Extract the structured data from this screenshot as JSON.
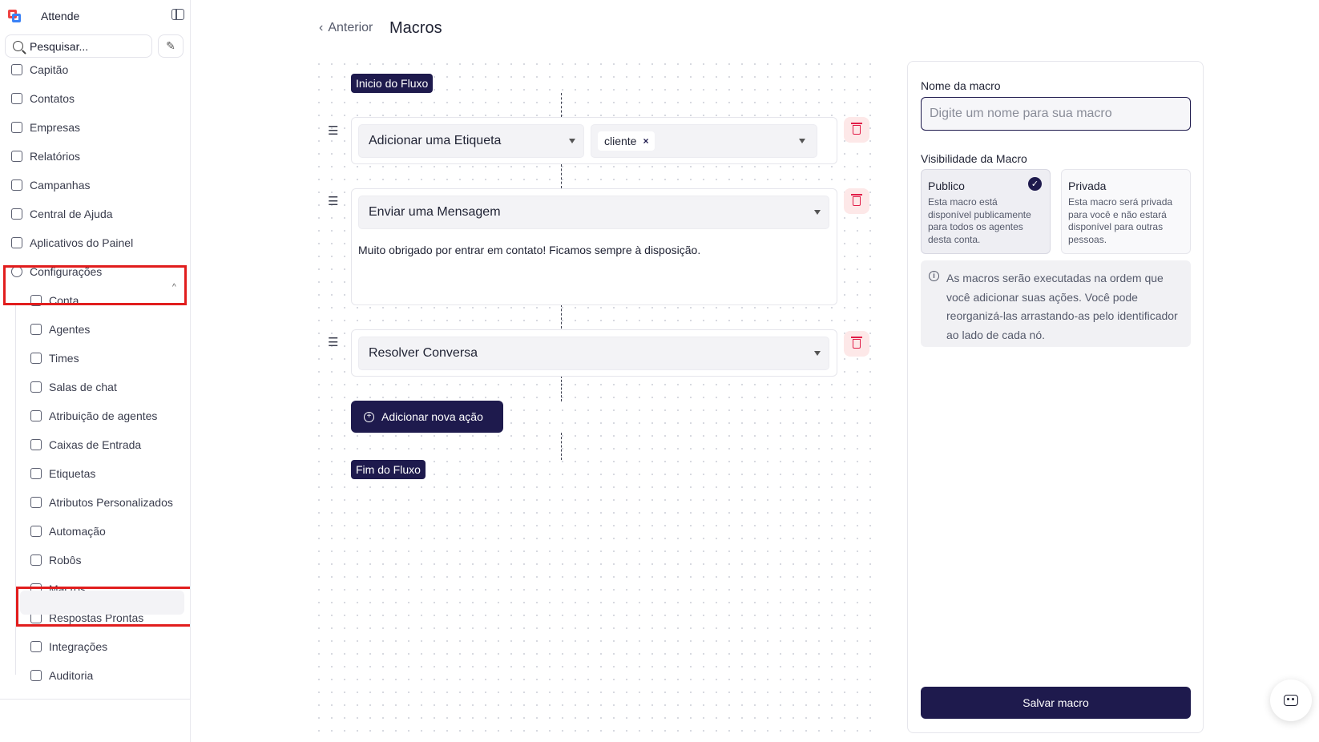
{
  "app": {
    "name": "Attende"
  },
  "search": {
    "placeholder": "Pesquisar..."
  },
  "sidebar": {
    "items": [
      {
        "label": "Capitão",
        "icon": "flag-icon"
      },
      {
        "label": "Contatos",
        "icon": "contact-icon"
      },
      {
        "label": "Empresas",
        "icon": "building-icon"
      },
      {
        "label": "Relatórios",
        "icon": "chart-icon"
      },
      {
        "label": "Campanhas",
        "icon": "megaphone-icon"
      },
      {
        "label": "Central de Ajuda",
        "icon": "library-icon"
      },
      {
        "label": "Aplicativos do Painel",
        "icon": "apps-icon"
      },
      {
        "label": "Configurações",
        "icon": "settings-icon"
      }
    ],
    "sub_items": [
      {
        "label": "Conta",
        "icon": "briefcase-icon"
      },
      {
        "label": "Agentes",
        "icon": "agent-icon"
      },
      {
        "label": "Times",
        "icon": "team-icon"
      },
      {
        "label": "Salas de chat",
        "icon": "chat-room-icon"
      },
      {
        "label": "Atribuição de agentes",
        "icon": "assign-icon"
      },
      {
        "label": "Caixas de Entrada",
        "icon": "inbox-icon"
      },
      {
        "label": "Etiquetas",
        "icon": "tag-icon"
      },
      {
        "label": "Atributos Personalizados",
        "icon": "code-icon"
      },
      {
        "label": "Automação",
        "icon": "automation-icon"
      },
      {
        "label": "Robôs",
        "icon": "bot-icon"
      },
      {
        "label": "Macros",
        "icon": "macro-icon"
      },
      {
        "label": "Respostas Prontas",
        "icon": "canned-icon"
      },
      {
        "label": "Integrações",
        "icon": "integration-icon"
      },
      {
        "label": "Auditoria",
        "icon": "audit-icon"
      }
    ],
    "active": "Macros"
  },
  "header": {
    "back_label": "Anterior",
    "title": "Macros"
  },
  "flow": {
    "start_label": "Inicio do Fluxo",
    "end_label": "Fim do Fluxo",
    "actions": [
      {
        "action": "Adicionar uma Etiqueta",
        "value_tag": "cliente"
      },
      {
        "action": "Enviar uma Mensagem",
        "message": "Muito obrigado por entrar em contato! Ficamos sempre à disposição."
      },
      {
        "action": "Resolver Conversa"
      }
    ],
    "add_action_label": "Adicionar nova ação"
  },
  "panel": {
    "name_label": "Nome da macro",
    "name_placeholder": "Digite um nome para sua macro",
    "visibility_label": "Visibilidade da Macro",
    "options": [
      {
        "title": "Publico",
        "desc": "Esta macro está disponível publicamente para todos os agentes desta conta.",
        "selected": true
      },
      {
        "title": "Privada",
        "desc": "Esta macro será privada para você e não estará disponível para outras pessoas.",
        "selected": false
      }
    ],
    "info": "As macros serão executadas na ordem que você adicionar suas ações. Você pode reorganizá-las arrastando-as pelo identificador ao lado de cada nó.",
    "save_label": "Salvar macro"
  },
  "colors": {
    "primary": "#1e1a4d",
    "danger": "#e11d48",
    "highlight": "#e11d1d"
  }
}
